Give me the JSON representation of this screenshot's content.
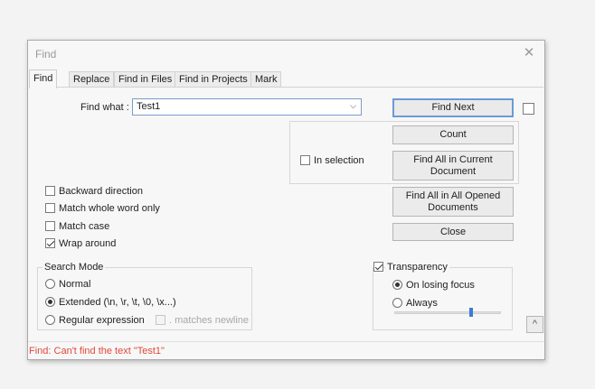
{
  "window": {
    "title": "Find",
    "close_glyph": "✕"
  },
  "tabs": [
    {
      "label": "Find"
    },
    {
      "label": "Replace"
    },
    {
      "label": "Find in Files"
    },
    {
      "label": "Find in Projects"
    },
    {
      "label": "Mark"
    }
  ],
  "find_what": {
    "label": "Find what :",
    "value": "Test1"
  },
  "buttons": {
    "find_next": "Find Next",
    "count": "Count",
    "find_all_current_1": "Find All in Current",
    "find_all_current_2": "Document",
    "find_all_opened_1": "Find All in All Opened",
    "find_all_opened_2": "Documents",
    "close": "Close",
    "collapse": "^"
  },
  "in_selection": {
    "label": "In selection",
    "checked": false
  },
  "options": [
    {
      "label": "Backward direction",
      "checked": false
    },
    {
      "label": "Match whole word only",
      "checked": false
    },
    {
      "label": "Match case",
      "checked": false
    },
    {
      "label": "Wrap around",
      "checked": true
    }
  ],
  "search_mode": {
    "title": "Search Mode",
    "normal": "Normal",
    "extended": "Extended (\\n, \\r, \\t, \\0, \\x...)",
    "regex": "Regular expression",
    "matches_newline": ". matches newline",
    "selected": "extended"
  },
  "transparency": {
    "label": "Transparency",
    "checked": true,
    "on_losing_focus": "On losing focus",
    "always": "Always",
    "selected": "on_losing_focus",
    "level": 0.72
  },
  "status": {
    "text": "Find: Can't find the text \"Test1\"",
    "color": "#e2483a"
  }
}
